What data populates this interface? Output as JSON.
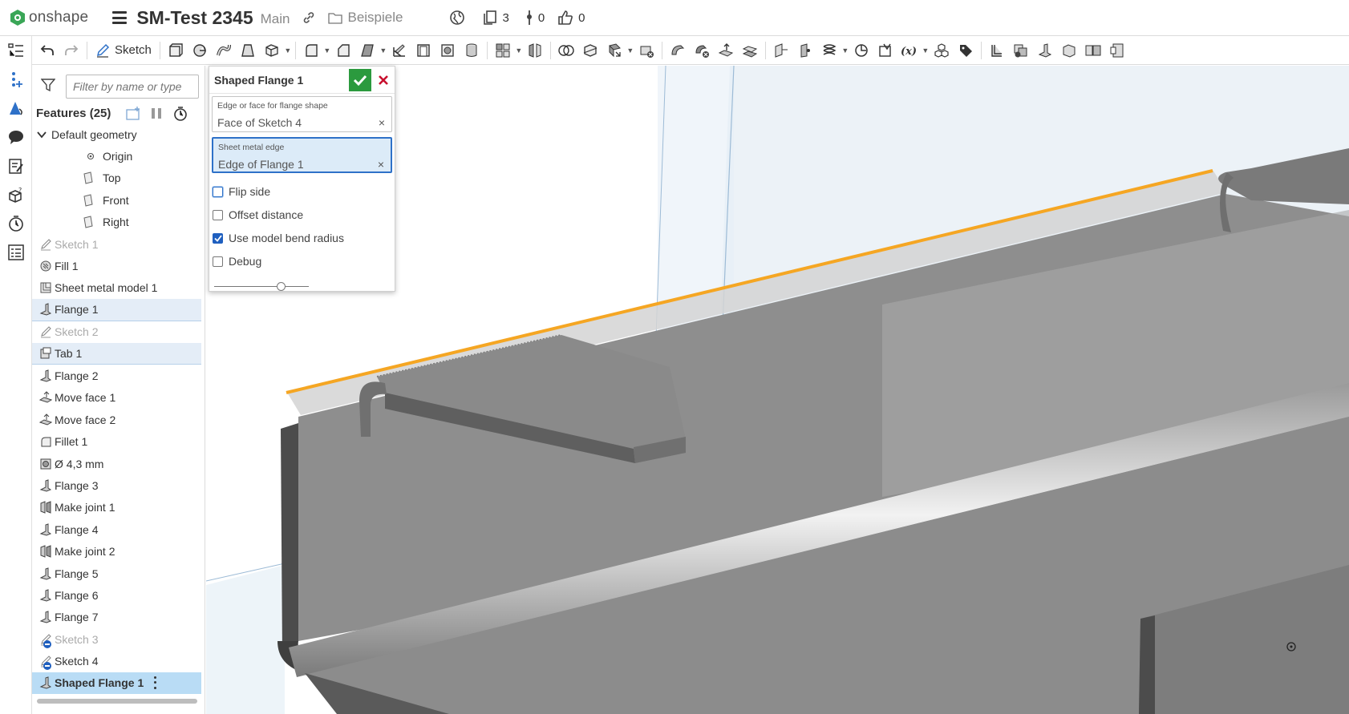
{
  "app": {
    "brand": "onshape",
    "document_title": "SM-Test 2345",
    "branch": "Main",
    "folder": "Beispiele",
    "versions_count": "3",
    "branches_count": "0",
    "likes_count": "0"
  },
  "toolbar": {
    "sketch_label": "Sketch"
  },
  "feature_panel": {
    "filter_placeholder": "Filter by name or type",
    "title": "Features (25)",
    "items": [
      {
        "label": "Default geometry",
        "icon": "chevron-down-icon",
        "kind": "group"
      },
      {
        "label": "Origin",
        "icon": "origin-icon",
        "kind": "child"
      },
      {
        "label": "Top",
        "icon": "plane-icon",
        "kind": "child"
      },
      {
        "label": "Front",
        "icon": "plane-icon",
        "kind": "child"
      },
      {
        "label": "Right",
        "icon": "plane-icon",
        "kind": "child"
      },
      {
        "label": "Sketch 1",
        "icon": "sketch-icon",
        "kind": "dim"
      },
      {
        "label": "Fill 1",
        "icon": "fill-icon",
        "kind": "normal"
      },
      {
        "label": "Sheet metal model 1",
        "icon": "sheet-metal-icon",
        "kind": "normal"
      },
      {
        "label": "Flange 1",
        "icon": "flange-icon",
        "kind": "highlight"
      },
      {
        "label": "Sketch 2",
        "icon": "sketch-icon",
        "kind": "dim"
      },
      {
        "label": "Tab 1",
        "icon": "tab-icon",
        "kind": "highlight"
      },
      {
        "label": "Flange 2",
        "icon": "flange-icon",
        "kind": "normal"
      },
      {
        "label": "Move face 1",
        "icon": "move-face-icon",
        "kind": "normal"
      },
      {
        "label": "Move face 2",
        "icon": "move-face-icon",
        "kind": "normal"
      },
      {
        "label": "Fillet 1",
        "icon": "fillet-icon",
        "kind": "normal"
      },
      {
        "label": "Ø 4,3 mm",
        "icon": "hole-icon",
        "kind": "normal"
      },
      {
        "label": "Flange 3",
        "icon": "flange-icon",
        "kind": "normal"
      },
      {
        "label": "Make joint 1",
        "icon": "joint-icon",
        "kind": "normal"
      },
      {
        "label": "Flange 4",
        "icon": "flange-icon",
        "kind": "normal"
      },
      {
        "label": "Make joint 2",
        "icon": "joint-icon",
        "kind": "normal"
      },
      {
        "label": "Flange 5",
        "icon": "flange-icon",
        "kind": "normal"
      },
      {
        "label": "Flange 6",
        "icon": "flange-icon",
        "kind": "normal"
      },
      {
        "label": "Flange 7",
        "icon": "flange-icon",
        "kind": "normal"
      },
      {
        "label": "Sketch 3",
        "icon": "sketch-icon",
        "kind": "dim"
      },
      {
        "label": "Sketch 4",
        "icon": "sketch-icon",
        "kind": "normal"
      },
      {
        "label": "Shaped Flange 1",
        "icon": "flange-icon",
        "kind": "selected"
      }
    ]
  },
  "dialog": {
    "title": "Shaped Flange 1",
    "field1_label": "Edge or face for flange shape",
    "field1_value": "Face of Sketch 4",
    "field2_label": "Sheet metal edge",
    "field2_value": "Edge of Flange 1",
    "clear_glyph": "×",
    "checkboxes": [
      {
        "label": "Flip side",
        "checked": false
      },
      {
        "label": "Offset distance",
        "checked": false
      },
      {
        "label": "Use model bend radius",
        "checked": true
      },
      {
        "label": "Debug",
        "checked": false
      }
    ],
    "slider_value": 0.7
  },
  "colors": {
    "accent": "#2e71c8",
    "ok": "#2b9a3e",
    "cancel": "#c8102e",
    "selection_edge": "#f5a623",
    "brand": "#3aa657"
  }
}
